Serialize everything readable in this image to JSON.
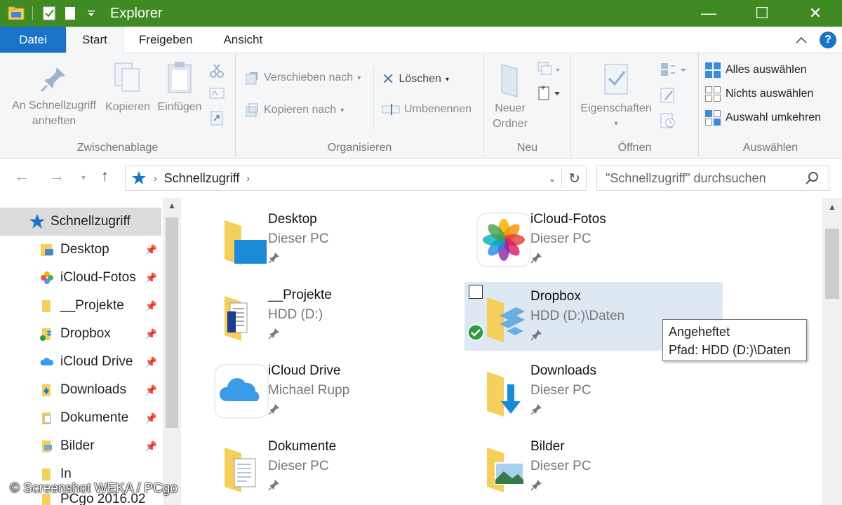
{
  "window": {
    "title": "Explorer",
    "accent": "#3f8a22"
  },
  "window_controls": {
    "minimize": "—",
    "maximize": "☐",
    "close": "✕"
  },
  "ribbon_tabs": [
    {
      "label": "Datei"
    },
    {
      "label": "Start"
    },
    {
      "label": "Freigeben"
    },
    {
      "label": "Ansicht"
    }
  ],
  "ribbon": {
    "clipboard": {
      "group_label": "Zwischenablage",
      "pin_line1": "An Schnellzugriff",
      "pin_line2": "anheften",
      "copy": "Kopieren",
      "paste": "Einfügen"
    },
    "organize": {
      "group_label": "Organisieren",
      "move_to": "Verschieben nach",
      "copy_to": "Kopieren nach",
      "delete": "Löschen",
      "rename": "Umbenennen"
    },
    "new": {
      "group_label": "Neu",
      "new_folder_line1": "Neuer",
      "new_folder_line2": "Ordner"
    },
    "open": {
      "group_label": "Öffnen",
      "properties": "Eigenschaften"
    },
    "select": {
      "group_label": "Auswählen",
      "select_all": "Alles auswählen",
      "select_none": "Nichts auswählen",
      "invert": "Auswahl umkehren"
    }
  },
  "address": {
    "path": "Schnellzugriff",
    "search_placeholder": "\"Schnellzugriff\" durchsuchen"
  },
  "nav": {
    "items": [
      {
        "label": "Schnellzugriff",
        "icon": "star-icon",
        "pinned": false
      },
      {
        "label": "Desktop",
        "icon": "desktop-folder-icon",
        "pinned": true
      },
      {
        "label": "iCloud-Fotos",
        "icon": "photos-icon",
        "pinned": true
      },
      {
        "label": "__Projekte",
        "icon": "folder-icon",
        "pinned": true
      },
      {
        "label": "Dropbox",
        "icon": "dropbox-icon",
        "pinned": true
      },
      {
        "label": "iCloud Drive",
        "icon": "icloud-icon",
        "pinned": true
      },
      {
        "label": "Downloads",
        "icon": "downloads-icon",
        "pinned": true
      },
      {
        "label": "Dokumente",
        "icon": "documents-icon",
        "pinned": true
      },
      {
        "label": "Bilder",
        "icon": "pictures-icon",
        "pinned": true
      },
      {
        "label": "In",
        "icon": "folder-icon",
        "pinned": false
      },
      {
        "label": "PCgo 2016.02",
        "icon": "folder-icon",
        "pinned": false
      }
    ]
  },
  "tiles": [
    {
      "name": "Desktop",
      "location": "Dieser PC",
      "icon": "desktop-folder-icon"
    },
    {
      "name": "iCloud-Fotos",
      "location": "Dieser PC",
      "icon": "photos-icon"
    },
    {
      "name": "__Projekte",
      "location": "HDD (D:)",
      "icon": "folder-docs-icon"
    },
    {
      "name": "Dropbox",
      "location": "HDD (D:)\\Daten",
      "icon": "dropbox-folder-icon"
    },
    {
      "name": "iCloud Drive",
      "location": "Michael Rupp",
      "icon": "icloud-icon"
    },
    {
      "name": "Downloads",
      "location": "Dieser PC",
      "icon": "downloads-folder-icon"
    },
    {
      "name": "Dokumente",
      "location": "Dieser PC",
      "icon": "documents-folder-icon"
    },
    {
      "name": "Bilder",
      "location": "Dieser PC",
      "icon": "pictures-folder-icon"
    }
  ],
  "tooltip": {
    "line1": "Angeheftet",
    "line2": "Pfad: HDD (D:)\\Daten"
  },
  "watermark": "© Screenshot WEKA / PCgo"
}
